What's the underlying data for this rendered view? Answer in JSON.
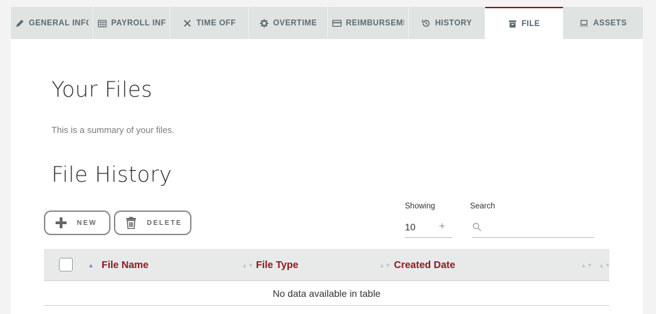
{
  "tabs": [
    {
      "label": "General Info",
      "icon": "pencil-icon",
      "active": false
    },
    {
      "label": "Payroll Info",
      "icon": "calendar-icon",
      "active": false
    },
    {
      "label": "Time Off",
      "icon": "plane-icon",
      "active": false
    },
    {
      "label": "Overtime",
      "icon": "gear-icon",
      "active": false
    },
    {
      "label": "Reimbursement",
      "icon": "card-icon",
      "active": false
    },
    {
      "label": "History",
      "icon": "history-icon",
      "active": false
    },
    {
      "label": "File",
      "icon": "archive-icon",
      "active": true
    },
    {
      "label": "Assets",
      "icon": "laptop-icon",
      "active": false
    }
  ],
  "files": {
    "title": "Your Files",
    "subtitle": "This is a summary of your files."
  },
  "history": {
    "title": "File History",
    "new_label": "NEW",
    "delete_label": "DELETE",
    "showing_label": "Showing",
    "showing_value": "10",
    "search_label": "Search",
    "search_placeholder": ""
  },
  "table": {
    "columns": [
      "File Name",
      "File Type",
      "Created Date"
    ],
    "empty_message": "No data available in table"
  },
  "colors": {
    "accent": "#8b1a1f",
    "tab_bg": "#dfe3e2",
    "header_bg": "#e8eaea",
    "sort_active": "#6f8fd8"
  }
}
